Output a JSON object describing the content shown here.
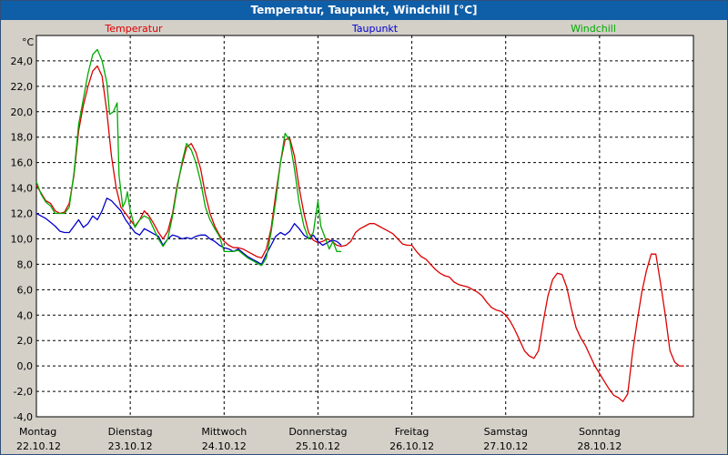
{
  "window": {
    "title": "Temperatur, Taupunkt, Windchill [°C]"
  },
  "colors": {
    "temperatur": "#dd0000",
    "taupunkt": "#0000cc",
    "windchill": "#00aa00",
    "plot_bg": "#ffffff",
    "frame_bg": "#d4d0c8"
  },
  "chart_data": {
    "type": "line",
    "title": "Temperatur, Taupunkt, Windchill [°C]",
    "ylabel": "°C",
    "ylim": [
      -4,
      26
    ],
    "yticks": [
      -4,
      -2,
      0,
      2,
      4,
      6,
      8,
      10,
      12,
      14,
      16,
      18,
      20,
      22,
      24
    ],
    "ytick_labels": [
      "-4,0",
      "-2,0",
      "0,0",
      "2,0",
      "4,0",
      "6,0",
      "8,0",
      "10,0",
      "12,0",
      "14,0",
      "16,0",
      "18,0",
      "20,0",
      "22,0",
      "24,0"
    ],
    "xlim": [
      0,
      7
    ],
    "x_unit": "days from Montag 22.10.12",
    "xticks": [
      {
        "x": 0,
        "day": "Montag",
        "date": "22.10.12"
      },
      {
        "x": 1,
        "day": "Dienstag",
        "date": "23.10.12"
      },
      {
        "x": 2,
        "day": "Mittwoch",
        "date": "24.10.12"
      },
      {
        "x": 3,
        "day": "Donnerstag",
        "date": "25.10.12"
      },
      {
        "x": 4,
        "day": "Freitag",
        "date": "26.10.12"
      },
      {
        "x": 5,
        "day": "Samstag",
        "date": "27.10.12"
      },
      {
        "x": 6,
        "day": "Sonntag",
        "date": "28.10.12"
      }
    ],
    "grid": true,
    "legend_position": "top",
    "series": [
      {
        "name": "Temperatur",
        "color": "#dd0000",
        "points": [
          [
            0.0,
            14.2
          ],
          [
            0.05,
            13.6
          ],
          [
            0.1,
            13.0
          ],
          [
            0.15,
            12.8
          ],
          [
            0.2,
            12.2
          ],
          [
            0.25,
            12.0
          ],
          [
            0.3,
            12.1
          ],
          [
            0.35,
            12.8
          ],
          [
            0.4,
            15.0
          ],
          [
            0.45,
            18.5
          ],
          [
            0.5,
            20.5
          ],
          [
            0.55,
            22.0
          ],
          [
            0.6,
            23.2
          ],
          [
            0.65,
            23.6
          ],
          [
            0.7,
            22.8
          ],
          [
            0.75,
            20.0
          ],
          [
            0.8,
            16.5
          ],
          [
            0.85,
            14.0
          ],
          [
            0.9,
            12.5
          ],
          [
            0.95,
            12.0
          ],
          [
            1.0,
            11.5
          ],
          [
            1.05,
            11.0
          ],
          [
            1.1,
            11.5
          ],
          [
            1.15,
            12.2
          ],
          [
            1.2,
            11.8
          ],
          [
            1.25,
            11.2
          ],
          [
            1.3,
            10.5
          ],
          [
            1.35,
            10.0
          ],
          [
            1.4,
            10.6
          ],
          [
            1.45,
            12.0
          ],
          [
            1.5,
            14.2
          ],
          [
            1.55,
            15.8
          ],
          [
            1.6,
            17.2
          ],
          [
            1.65,
            17.5
          ],
          [
            1.7,
            16.8
          ],
          [
            1.75,
            15.5
          ],
          [
            1.8,
            13.5
          ],
          [
            1.85,
            12.0
          ],
          [
            1.9,
            11.0
          ],
          [
            1.95,
            10.3
          ],
          [
            2.0,
            9.8
          ],
          [
            2.05,
            9.5
          ],
          [
            2.1,
            9.3
          ],
          [
            2.15,
            9.3
          ],
          [
            2.2,
            9.2
          ],
          [
            2.25,
            9.0
          ],
          [
            2.3,
            8.8
          ],
          [
            2.35,
            8.6
          ],
          [
            2.4,
            8.5
          ],
          [
            2.45,
            9.2
          ],
          [
            2.5,
            10.8
          ],
          [
            2.55,
            13.5
          ],
          [
            2.6,
            16.0
          ],
          [
            2.65,
            17.8
          ],
          [
            2.7,
            17.9
          ],
          [
            2.75,
            16.5
          ],
          [
            2.8,
            14.0
          ],
          [
            2.85,
            12.0
          ],
          [
            2.9,
            10.5
          ],
          [
            2.95,
            9.9
          ],
          [
            3.0,
            9.7
          ],
          [
            3.05,
            9.8
          ],
          [
            3.1,
            10.0
          ],
          [
            3.15,
            9.8
          ],
          [
            3.2,
            9.5
          ],
          [
            3.25,
            9.4
          ],
          [
            3.3,
            9.5
          ],
          [
            3.35,
            9.8
          ],
          [
            3.4,
            10.5
          ],
          [
            3.45,
            10.8
          ],
          [
            3.5,
            11.0
          ],
          [
            3.55,
            11.2
          ],
          [
            3.6,
            11.2
          ],
          [
            3.65,
            11.0
          ],
          [
            3.7,
            10.8
          ],
          [
            3.75,
            10.6
          ],
          [
            3.8,
            10.4
          ],
          [
            3.85,
            10.0
          ],
          [
            3.9,
            9.6
          ],
          [
            3.95,
            9.5
          ],
          [
            4.0,
            9.5
          ],
          [
            4.05,
            9.0
          ],
          [
            4.1,
            8.6
          ],
          [
            4.15,
            8.4
          ],
          [
            4.2,
            8.0
          ],
          [
            4.25,
            7.6
          ],
          [
            4.3,
            7.3
          ],
          [
            4.35,
            7.1
          ],
          [
            4.4,
            7.0
          ],
          [
            4.45,
            6.6
          ],
          [
            4.5,
            6.4
          ],
          [
            4.55,
            6.3
          ],
          [
            4.6,
            6.2
          ],
          [
            4.65,
            6.0
          ],
          [
            4.7,
            5.8
          ],
          [
            4.75,
            5.5
          ],
          [
            4.8,
            5.0
          ],
          [
            4.85,
            4.6
          ],
          [
            4.9,
            4.4
          ],
          [
            4.95,
            4.3
          ],
          [
            5.0,
            4.0
          ],
          [
            5.05,
            3.5
          ],
          [
            5.1,
            2.8
          ],
          [
            5.15,
            2.0
          ],
          [
            5.2,
            1.2
          ],
          [
            5.25,
            0.8
          ],
          [
            5.3,
            0.6
          ],
          [
            5.35,
            1.2
          ],
          [
            5.4,
            3.5
          ],
          [
            5.45,
            5.5
          ],
          [
            5.5,
            6.8
          ],
          [
            5.55,
            7.3
          ],
          [
            5.6,
            7.2
          ],
          [
            5.65,
            6.2
          ],
          [
            5.7,
            4.5
          ],
          [
            5.75,
            3.0
          ],
          [
            5.8,
            2.2
          ],
          [
            5.85,
            1.6
          ],
          [
            5.9,
            0.8
          ],
          [
            5.95,
            0.0
          ],
          [
            6.0,
            -0.6
          ],
          [
            6.05,
            -1.2
          ],
          [
            6.1,
            -1.8
          ],
          [
            6.15,
            -2.3
          ],
          [
            6.2,
            -2.5
          ],
          [
            6.25,
            -2.8
          ],
          [
            6.3,
            -2.2
          ],
          [
            6.35,
            1.0
          ],
          [
            6.4,
            3.5
          ],
          [
            6.45,
            5.8
          ],
          [
            6.5,
            7.5
          ],
          [
            6.55,
            8.8
          ],
          [
            6.6,
            8.8
          ],
          [
            6.65,
            6.5
          ],
          [
            6.7,
            4.0
          ],
          [
            6.75,
            1.2
          ],
          [
            6.8,
            0.3
          ],
          [
            6.85,
            0.0
          ],
          [
            6.9,
            0.0
          ]
        ]
      },
      {
        "name": "Taupunkt",
        "color": "#0000cc",
        "points": [
          [
            0.0,
            12.0
          ],
          [
            0.05,
            11.8
          ],
          [
            0.1,
            11.6
          ],
          [
            0.15,
            11.3
          ],
          [
            0.2,
            11.0
          ],
          [
            0.25,
            10.6
          ],
          [
            0.3,
            10.5
          ],
          [
            0.35,
            10.5
          ],
          [
            0.4,
            11.0
          ],
          [
            0.45,
            11.5
          ],
          [
            0.5,
            10.9
          ],
          [
            0.55,
            11.2
          ],
          [
            0.6,
            11.8
          ],
          [
            0.65,
            11.5
          ],
          [
            0.7,
            12.2
          ],
          [
            0.75,
            13.2
          ],
          [
            0.8,
            13.0
          ],
          [
            0.85,
            12.6
          ],
          [
            0.9,
            12.2
          ],
          [
            0.95,
            11.5
          ],
          [
            1.0,
            11.0
          ],
          [
            1.05,
            10.5
          ],
          [
            1.1,
            10.3
          ],
          [
            1.15,
            10.8
          ],
          [
            1.2,
            10.6
          ],
          [
            1.25,
            10.4
          ],
          [
            1.3,
            10.2
          ],
          [
            1.35,
            9.5
          ],
          [
            1.4,
            10.0
          ],
          [
            1.45,
            10.3
          ],
          [
            1.5,
            10.2
          ],
          [
            1.55,
            10.0
          ],
          [
            1.6,
            10.1
          ],
          [
            1.65,
            10.0
          ],
          [
            1.7,
            10.2
          ],
          [
            1.75,
            10.3
          ],
          [
            1.8,
            10.3
          ],
          [
            1.85,
            10.0
          ],
          [
            1.9,
            9.8
          ],
          [
            1.95,
            9.5
          ],
          [
            2.0,
            9.3
          ],
          [
            2.05,
            9.2
          ],
          [
            2.1,
            9.0
          ],
          [
            2.15,
            9.2
          ],
          [
            2.2,
            8.9
          ],
          [
            2.25,
            8.6
          ],
          [
            2.3,
            8.4
          ],
          [
            2.35,
            8.2
          ],
          [
            2.4,
            8.0
          ],
          [
            2.45,
            8.8
          ],
          [
            2.5,
            9.5
          ],
          [
            2.55,
            10.2
          ],
          [
            2.6,
            10.5
          ],
          [
            2.65,
            10.3
          ],
          [
            2.7,
            10.6
          ],
          [
            2.75,
            11.2
          ],
          [
            2.8,
            10.8
          ],
          [
            2.85,
            10.3
          ],
          [
            2.9,
            10.0
          ],
          [
            2.95,
            10.3
          ],
          [
            3.0,
            9.8
          ],
          [
            3.05,
            9.5
          ],
          [
            3.1,
            9.7
          ],
          [
            3.15,
            9.9
          ],
          [
            3.2,
            9.8
          ],
          [
            3.25,
            9.5
          ]
        ]
      },
      {
        "name": "Windchill",
        "color": "#00aa00",
        "points": [
          [
            0.0,
            14.5
          ],
          [
            0.05,
            13.5
          ],
          [
            0.1,
            12.9
          ],
          [
            0.15,
            12.6
          ],
          [
            0.2,
            12.0
          ],
          [
            0.25,
            12.0
          ],
          [
            0.3,
            12.0
          ],
          [
            0.35,
            12.5
          ],
          [
            0.4,
            15.2
          ],
          [
            0.45,
            19.0
          ],
          [
            0.5,
            21.0
          ],
          [
            0.55,
            23.0
          ],
          [
            0.6,
            24.5
          ],
          [
            0.65,
            24.9
          ],
          [
            0.7,
            24.0
          ],
          [
            0.75,
            22.3
          ],
          [
            0.78,
            19.8
          ],
          [
            0.82,
            20.0
          ],
          [
            0.86,
            20.7
          ],
          [
            0.88,
            15.0
          ],
          [
            0.92,
            12.5
          ],
          [
            0.95,
            13.0
          ],
          [
            0.97,
            13.7
          ],
          [
            1.0,
            12.2
          ],
          [
            1.05,
            10.9
          ],
          [
            1.1,
            11.5
          ],
          [
            1.15,
            11.8
          ],
          [
            1.2,
            11.6
          ],
          [
            1.25,
            10.8
          ],
          [
            1.3,
            10.0
          ],
          [
            1.35,
            9.4
          ],
          [
            1.4,
            10.0
          ],
          [
            1.45,
            11.8
          ],
          [
            1.5,
            14.0
          ],
          [
            1.55,
            16.0
          ],
          [
            1.6,
            17.5
          ],
          [
            1.65,
            17.0
          ],
          [
            1.7,
            16.0
          ],
          [
            1.75,
            14.5
          ],
          [
            1.8,
            12.5
          ],
          [
            1.85,
            11.5
          ],
          [
            1.9,
            10.8
          ],
          [
            1.95,
            10.2
          ],
          [
            2.0,
            9.0
          ],
          [
            2.05,
            9.0
          ],
          [
            2.1,
            9.0
          ],
          [
            2.15,
            9.1
          ],
          [
            2.2,
            8.8
          ],
          [
            2.25,
            8.5
          ],
          [
            2.3,
            8.3
          ],
          [
            2.35,
            8.1
          ],
          [
            2.4,
            7.9
          ],
          [
            2.45,
            8.5
          ],
          [
            2.5,
            10.5
          ],
          [
            2.55,
            13.0
          ],
          [
            2.6,
            16.0
          ],
          [
            2.65,
            18.3
          ],
          [
            2.7,
            17.7
          ],
          [
            2.75,
            15.5
          ],
          [
            2.8,
            12.8
          ],
          [
            2.85,
            11.0
          ],
          [
            2.9,
            10.0
          ],
          [
            2.95,
            10.5
          ],
          [
            3.0,
            13.0
          ],
          [
            3.03,
            11.0
          ],
          [
            3.08,
            10.0
          ],
          [
            3.12,
            9.2
          ],
          [
            3.16,
            9.8
          ],
          [
            3.2,
            9.0
          ],
          [
            3.25,
            9.0
          ]
        ]
      }
    ]
  }
}
